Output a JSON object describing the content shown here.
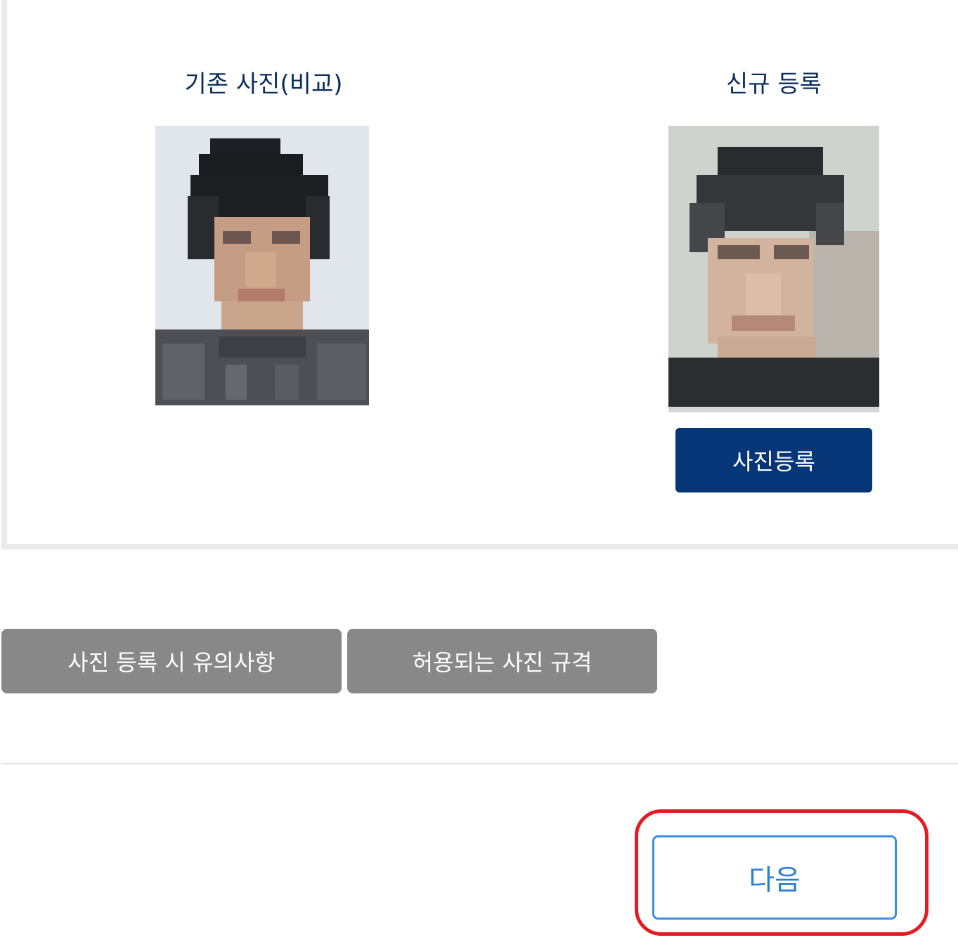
{
  "photos": {
    "existing_title": "기존 사진(비교)",
    "new_title": "신규 등록"
  },
  "buttons": {
    "register_photo": "사진등록",
    "photo_notice": "사진 등록 시 유의사항",
    "allowed_spec": "허용되는 사진 규격",
    "next": "다음"
  },
  "colors": {
    "primary": "#063677",
    "secondary_button": "#888888",
    "next_border": "#3d8fe6",
    "highlight": "#e31b23"
  }
}
